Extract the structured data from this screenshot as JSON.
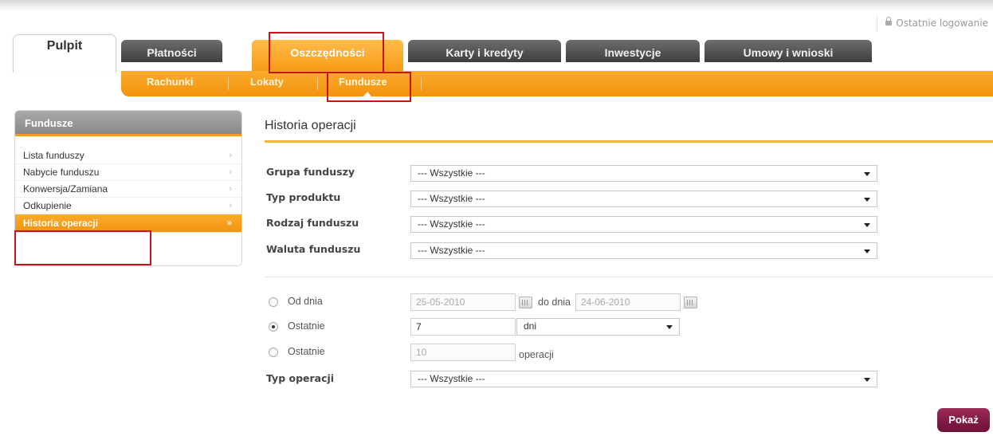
{
  "header": {
    "last_login_label": "Ostatnie logowanie"
  },
  "tabs": [
    {
      "label": "Pulpit"
    },
    {
      "label": "Płatności"
    },
    {
      "label": "Oszczędności"
    },
    {
      "label": "Karty i kredyty"
    },
    {
      "label": "Inwestycje"
    },
    {
      "label": "Umowy i wnioski"
    }
  ],
  "subnav": [
    {
      "label": "Rachunki"
    },
    {
      "label": "Lokaty"
    },
    {
      "label": "Fundusze"
    }
  ],
  "sidebar": {
    "title": "Fundusze",
    "items": [
      {
        "label": "Lista funduszy",
        "chevron": "›"
      },
      {
        "label": "Nabycie funduszu",
        "chevron": "›"
      },
      {
        "label": "Konwersja/Zamiana",
        "chevron": "›"
      },
      {
        "label": "Odkupienie",
        "chevron": "›"
      },
      {
        "label": "Historia operacji",
        "chevron": "»"
      }
    ]
  },
  "main": {
    "title": "Historia operacji",
    "filters": [
      {
        "label": "Grupa funduszy",
        "value": "--- Wszystkie ---"
      },
      {
        "label": "Typ produktu",
        "value": "--- Wszystkie ---"
      },
      {
        "label": "Rodzaj funduszu",
        "value": "--- Wszystkie ---"
      },
      {
        "label": "Waluta funduszu",
        "value": "--- Wszystkie ---"
      }
    ],
    "range": {
      "from_label": "Od dnia",
      "from_value": "25-05-2010",
      "to_label": "do dnia",
      "to_value": "24-06-2010",
      "last_label": "Ostatnie",
      "last_days_value": "7",
      "last_days_unit": "dni",
      "last_ops_label": "Ostatnie",
      "last_ops_value": "10",
      "last_ops_unit": "operacji"
    },
    "operation_type": {
      "label": "Typ operacji",
      "value": "--- Wszystkie ---"
    },
    "show_button": "Pokaż"
  },
  "colors": {
    "accent_orange": "#f59b16",
    "highlight_red": "#c8151c",
    "button_maroon": "#7a1540"
  },
  "icons": [
    "lock-icon",
    "chevron-right-icon",
    "double-chevron-right-icon",
    "calendar-icon",
    "dropdown-arrow-icon",
    "radio-icon"
  ]
}
